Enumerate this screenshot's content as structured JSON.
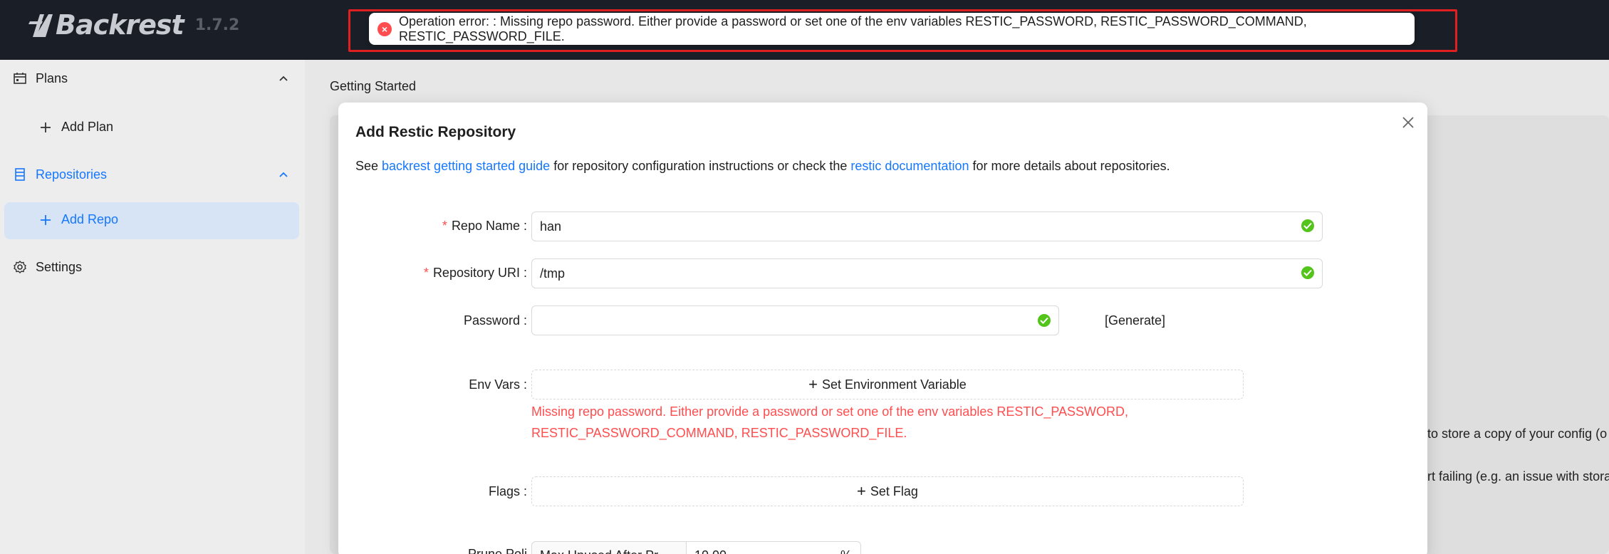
{
  "app": {
    "name": "Backrest",
    "version": "1.7.2"
  },
  "notification": {
    "message": "Operation error: : Missing repo password. Either provide a password or set one of the env variables RESTIC_PASSWORD, RESTIC_PASSWORD_COMMAND, RESTIC_PASSWORD_FILE."
  },
  "sidebar": {
    "plans_label": "Plans",
    "add_plan_label": "Add Plan",
    "repositories_label": "Repositories",
    "add_repo_label": "Add Repo",
    "settings_label": "Settings"
  },
  "main": {
    "breadcrumb": "Getting Started",
    "background_line_1": "to store a copy of your config (o",
    "background_line_2": "rt failing (e.g. an issue with stora"
  },
  "modal": {
    "title": "Add Restic Repository",
    "desc_prefix": "See ",
    "desc_link_1": "backrest getting started guide",
    "desc_middle": " for repository configuration instructions or check the ",
    "desc_link_2": "restic documentation",
    "desc_suffix": " for more details about repositories.",
    "fields": {
      "repo_name_label": "Repo Name",
      "repo_name_value": "han",
      "repo_uri_label": "Repository URI",
      "repo_uri_value": "/tmp",
      "password_label": "Password",
      "password_value": "",
      "generate_label": "[Generate]",
      "env_vars_label": "Env Vars",
      "env_vars_button": "Set Environment Variable",
      "env_vars_error": "Missing repo password. Either provide a password or set one of the env variables RESTIC_PASSWORD, RESTIC_PASSWORD_COMMAND, RESTIC_PASSWORD_FILE.",
      "flags_label": "Flags",
      "flags_button": "Set Flag",
      "prune_label": "Prune Poli",
      "prune_option": "Max Unused After Pr",
      "prune_value": "10.00",
      "prune_unit": "%"
    }
  },
  "colors": {
    "header_bg": "#1a1e26",
    "accent": "#1677ff",
    "error": "#ff4d4f",
    "success": "#52c41a",
    "selected_bg": "#d6e4f5"
  }
}
